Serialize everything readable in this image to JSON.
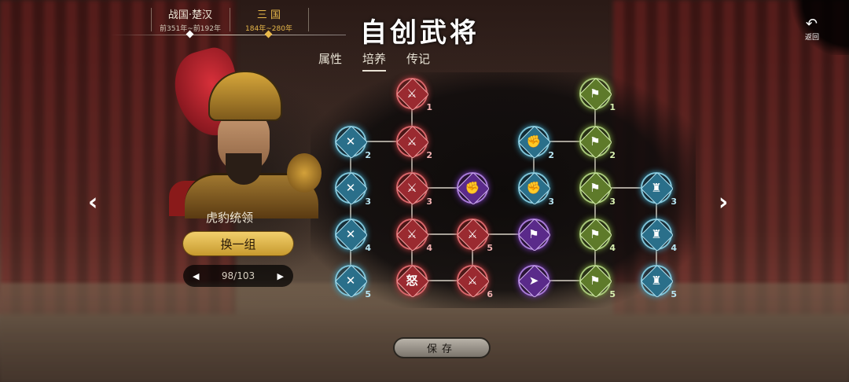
{
  "eras": [
    {
      "name": "战国·楚汉",
      "years": "前351年~前192年",
      "active": false
    },
    {
      "name": "三 国",
      "years": "184年~280年",
      "active": true
    }
  ],
  "title": "自创武将",
  "back": {
    "icon": "back-arrow-icon",
    "label": "返回"
  },
  "tabs": [
    {
      "label": "属性",
      "active": false
    },
    {
      "label": "培养",
      "active": true
    },
    {
      "label": "传记",
      "active": false
    }
  ],
  "hero": {
    "name": "虎豹统领",
    "swap_label": "换一组",
    "page_count": "98/103",
    "prev_icon": "◀",
    "next_icon": "▶"
  },
  "nav": {
    "left": "‹",
    "right": "›"
  },
  "save_label": "保存",
  "colors": {
    "red": "#d8666a",
    "cyan": "#7ec3d8",
    "purple": "#a87ad8",
    "green": "#a8c87a",
    "gold": "#e8b84a"
  },
  "skill_tree": {
    "nodes": [
      {
        "id": "r1",
        "color": "red",
        "icon": "blade-icon",
        "glyph": "⚔",
        "level": "1"
      },
      {
        "id": "r2",
        "color": "red",
        "icon": "blade-icon",
        "glyph": "⚔",
        "level": "2"
      },
      {
        "id": "r3",
        "color": "red",
        "icon": "blade-icon",
        "glyph": "⚔",
        "level": "3"
      },
      {
        "id": "r4",
        "color": "red",
        "icon": "blade-icon",
        "glyph": "⚔",
        "level": "4"
      },
      {
        "id": "r5",
        "color": "red",
        "icon": "blade-icon",
        "glyph": "⚔",
        "level": "5"
      },
      {
        "id": "r6",
        "color": "red",
        "icon": "blade-icon",
        "glyph": "⚔",
        "level": "6"
      },
      {
        "id": "rn",
        "color": "red",
        "icon": "rage-icon",
        "glyph": "怒",
        "level": ""
      },
      {
        "id": "c1",
        "color": "cyan",
        "icon": "double-strike-icon",
        "glyph": "✕",
        "level": "2"
      },
      {
        "id": "c2",
        "color": "cyan",
        "icon": "double-strike-icon",
        "glyph": "✕",
        "level": "3"
      },
      {
        "id": "c3",
        "color": "cyan",
        "icon": "double-strike-icon",
        "glyph": "✕",
        "level": "4"
      },
      {
        "id": "c4",
        "color": "cyan",
        "icon": "double-strike-icon",
        "glyph": "✕",
        "level": "5"
      },
      {
        "id": "p1",
        "color": "purple",
        "icon": "fist-icon",
        "glyph": "✊",
        "level": ""
      },
      {
        "id": "p2",
        "color": "purple",
        "icon": "banner-icon",
        "glyph": "⚑",
        "level": ""
      },
      {
        "id": "p3",
        "color": "purple",
        "icon": "charge-icon",
        "glyph": "➤",
        "level": ""
      },
      {
        "id": "f1",
        "color": "cyan",
        "icon": "fist-icon",
        "glyph": "✊",
        "level": "2"
      },
      {
        "id": "f2",
        "color": "cyan",
        "icon": "fist-icon",
        "glyph": "✊",
        "level": "3"
      },
      {
        "id": "g1",
        "color": "green",
        "icon": "flag-icon",
        "glyph": "⚑",
        "level": "1"
      },
      {
        "id": "g2",
        "color": "green",
        "icon": "flag-icon",
        "glyph": "⚑",
        "level": "2"
      },
      {
        "id": "g3",
        "color": "green",
        "icon": "flag-icon",
        "glyph": "⚑",
        "level": "3"
      },
      {
        "id": "g4",
        "color": "green",
        "icon": "flag-icon",
        "glyph": "⚑",
        "level": "4"
      },
      {
        "id": "g5",
        "color": "green",
        "icon": "flag-icon",
        "glyph": "⚑",
        "level": "5"
      },
      {
        "id": "t1",
        "color": "cyan",
        "icon": "troops-icon",
        "glyph": "♜",
        "level": "3"
      },
      {
        "id": "t2",
        "color": "cyan",
        "icon": "troops-icon",
        "glyph": "♜",
        "level": "4"
      },
      {
        "id": "t3",
        "color": "cyan",
        "icon": "troops-icon",
        "glyph": "♜",
        "level": "5"
      }
    ]
  }
}
